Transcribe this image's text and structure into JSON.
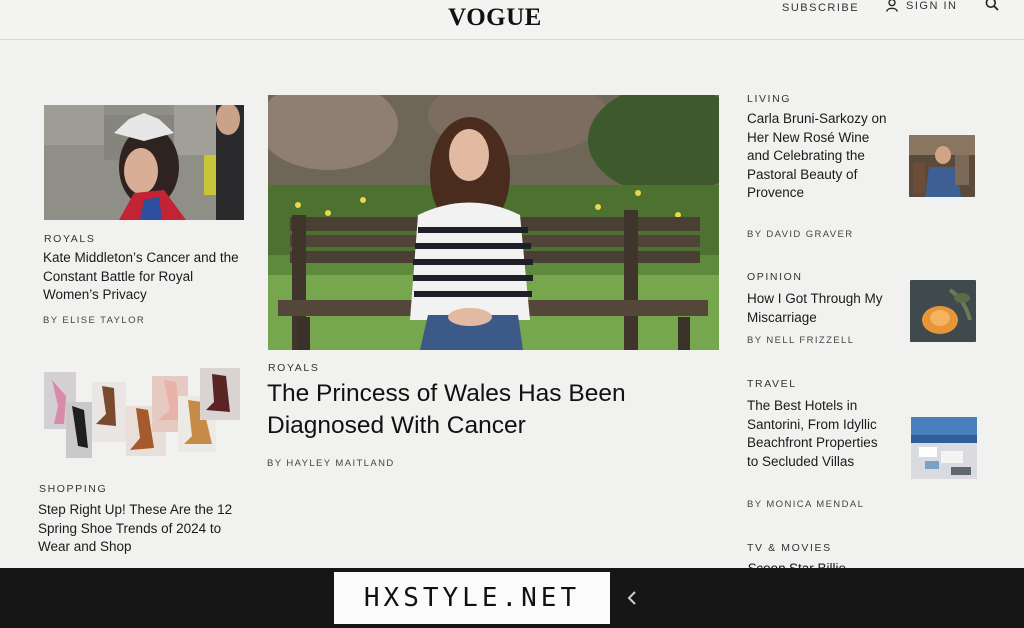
{
  "header": {
    "logo": "VOGUE",
    "subscribe": "SUBSCRIBE",
    "sign_in": "SIGN IN"
  },
  "left": {
    "story1": {
      "kicker": "ROYALS",
      "headline": "Kate Middleton’s Cancer and the Constant Battle for Royal Women’s Privacy",
      "byline": "BY ELISE TAYLOR"
    },
    "story2": {
      "kicker": "SHOPPING",
      "headline": "Step Right Up! These Are the 12 Spring Shoe Trends of 2024 to Wear and Shop"
    }
  },
  "main": {
    "kicker": "ROYALS",
    "headline": "The Princess of Wales Has Been Diagnosed With Cancer",
    "byline": "BY HAYLEY MAITLAND"
  },
  "right": {
    "items": [
      {
        "kicker": "LIVING",
        "headline": "Carla Bruni-Sarkozy on Her New Rosé Wine and Celebrating the Pastoral Beauty of Provence",
        "byline": "BY DAVID GRAVER"
      },
      {
        "kicker": "OPINION",
        "headline": "How I Got Through My Miscarriage",
        "byline": "BY NELL FRIZZELL"
      },
      {
        "kicker": "TRAVEL",
        "headline": "The Best Hotels in Santorini, From Idyllic Beachfront Properties to Secluded Villas",
        "byline": "BY MONICA MENDAL"
      },
      {
        "kicker": "TV & MOVIES",
        "headline_italic": "Scoop",
        "headline_rest": " Star Billie"
      }
    ]
  },
  "watermark": "HXSTYLE.NET",
  "colors": {
    "page_bg": "#f1f1ef",
    "text": "#1a1a1a",
    "bezel": "#161616"
  },
  "icons": [
    "user-icon",
    "search-icon",
    "chevron-left-icon"
  ]
}
